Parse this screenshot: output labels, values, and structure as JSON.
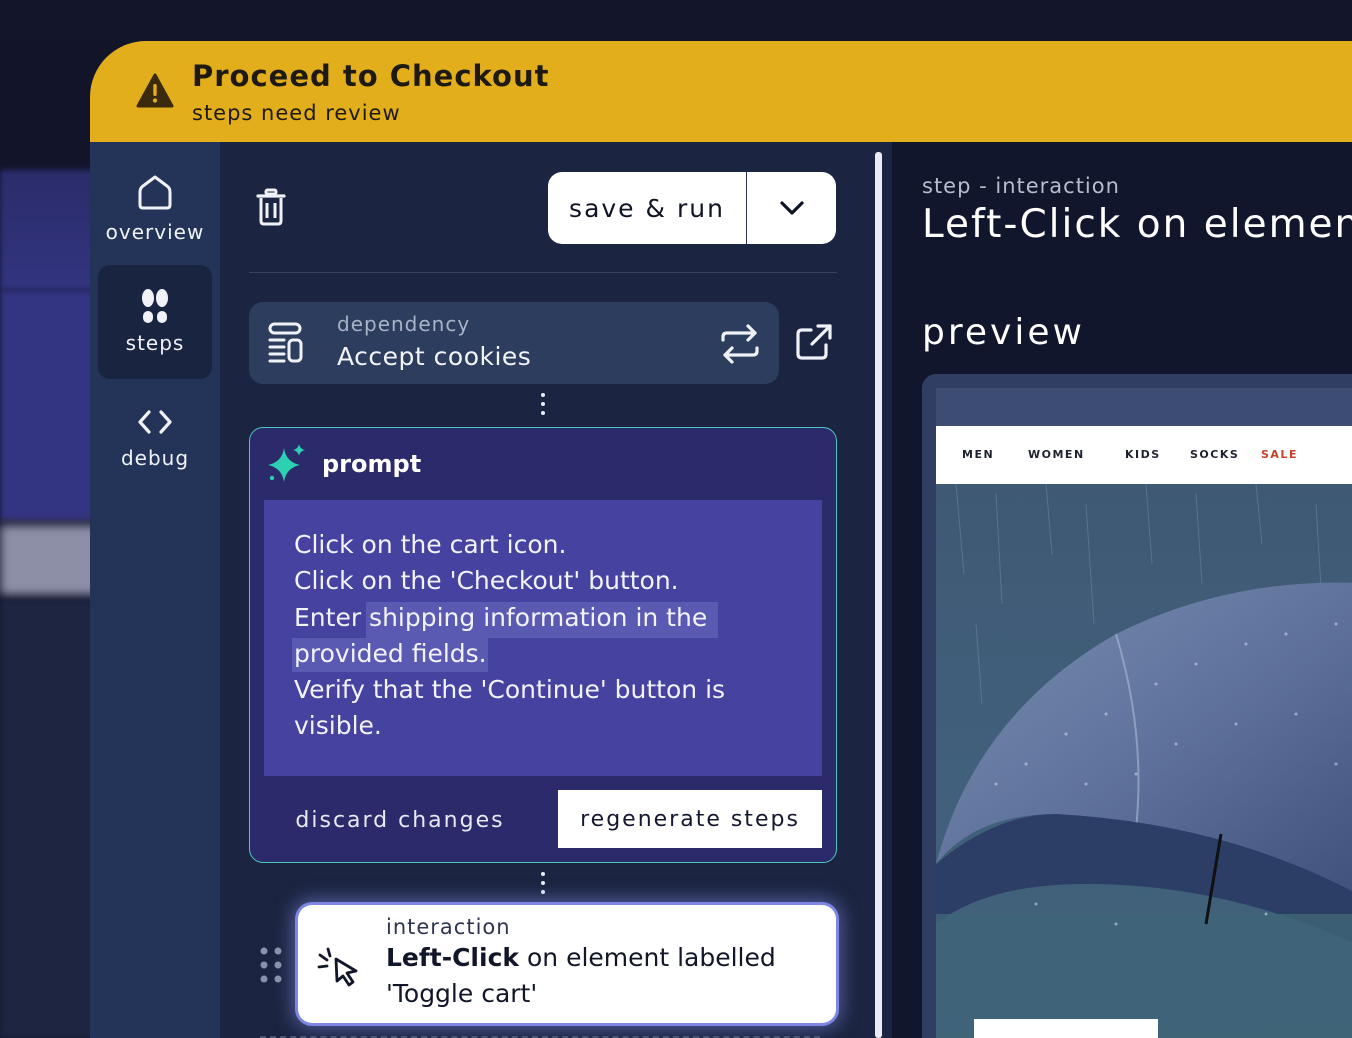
{
  "banner": {
    "title": "Proceed to Checkout",
    "subtitle": "steps need review",
    "icon": "warning-triangle-icon",
    "color": "#e2ae1c"
  },
  "nav": {
    "items": [
      {
        "label": "overview",
        "icon": "home-icon",
        "active": false
      },
      {
        "label": "steps",
        "icon": "footprints-icon",
        "active": true
      },
      {
        "label": "debug",
        "icon": "code-brackets-icon",
        "active": false
      }
    ]
  },
  "toolbar": {
    "delete_icon": "trash-icon",
    "save_run_label": "save & run",
    "dropdown_icon": "chevron-down-icon"
  },
  "dependency": {
    "label": "dependency",
    "name": "Accept cookies",
    "icon": "dependency-stack-icon",
    "swap_icon": "swap-arrows-icon",
    "open_icon": "external-link-icon"
  },
  "prompt": {
    "title": "prompt",
    "icon": "sparkle-icon",
    "lines": [
      "Click on the cart icon.",
      "Click on the 'Checkout' button.",
      "Enter shipping information in the",
      "provided fields.",
      "Verify that the 'Continue' button is",
      "visible."
    ],
    "discard_label": "discard changes",
    "regenerate_label": "regenerate steps",
    "accent": "#49c7c0"
  },
  "interaction_step": {
    "type": "interaction",
    "action": "Left-Click",
    "rest": " on element labelled",
    "target": "'Toggle cart'",
    "icon": "cursor-click-icon"
  },
  "right_panel": {
    "step_label": "step - interaction",
    "step_title": "Left-Click on element",
    "preview_label": "preview",
    "preview_nav": [
      "MEN",
      "WOMEN",
      "KIDS",
      "SOCKS",
      "SALE"
    ]
  }
}
